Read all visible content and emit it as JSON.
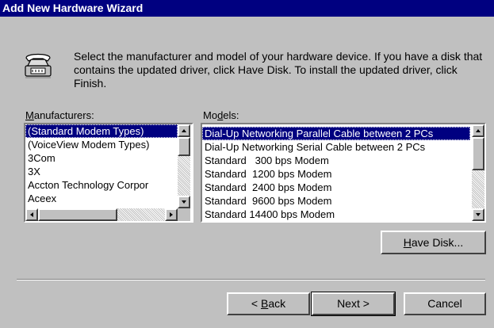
{
  "window": {
    "title": "Add New Hardware Wizard"
  },
  "instruction": "Select the manufacturer and model of your hardware device. If you have a disk that contains the updated driver, click Have Disk. To install the updated driver, click Finish.",
  "manufacturers": {
    "label_pre": "",
    "label_accel": "M",
    "label_post": "anufacturers:",
    "items": [
      "(Standard Modem Types)",
      "(VoiceView Modem Types)",
      "3Com",
      "3X",
      "Accton Technology Corpor",
      "Aceex"
    ],
    "selected_index": 0
  },
  "models": {
    "label_pre": "Mo",
    "label_accel": "d",
    "label_post": "els:",
    "items": [
      "Dial-Up Networking Parallel Cable between 2 PCs",
      "Dial-Up Networking Serial Cable between 2 PCs",
      "Standard   300 bps Modem",
      "Standard  1200 bps Modem",
      "Standard  2400 bps Modem",
      "Standard  9600 bps Modem",
      "Standard 14400 bps Modem"
    ],
    "selected_index": 0
  },
  "buttons": {
    "have_disk": {
      "pre": "",
      "accel": "H",
      "post": "ave Disk..."
    },
    "back": {
      "pre": "< ",
      "accel": "B",
      "post": "ack"
    },
    "next": "Next >",
    "cancel": "Cancel"
  },
  "icons": {
    "wizard": "telephone-modem-icon"
  }
}
